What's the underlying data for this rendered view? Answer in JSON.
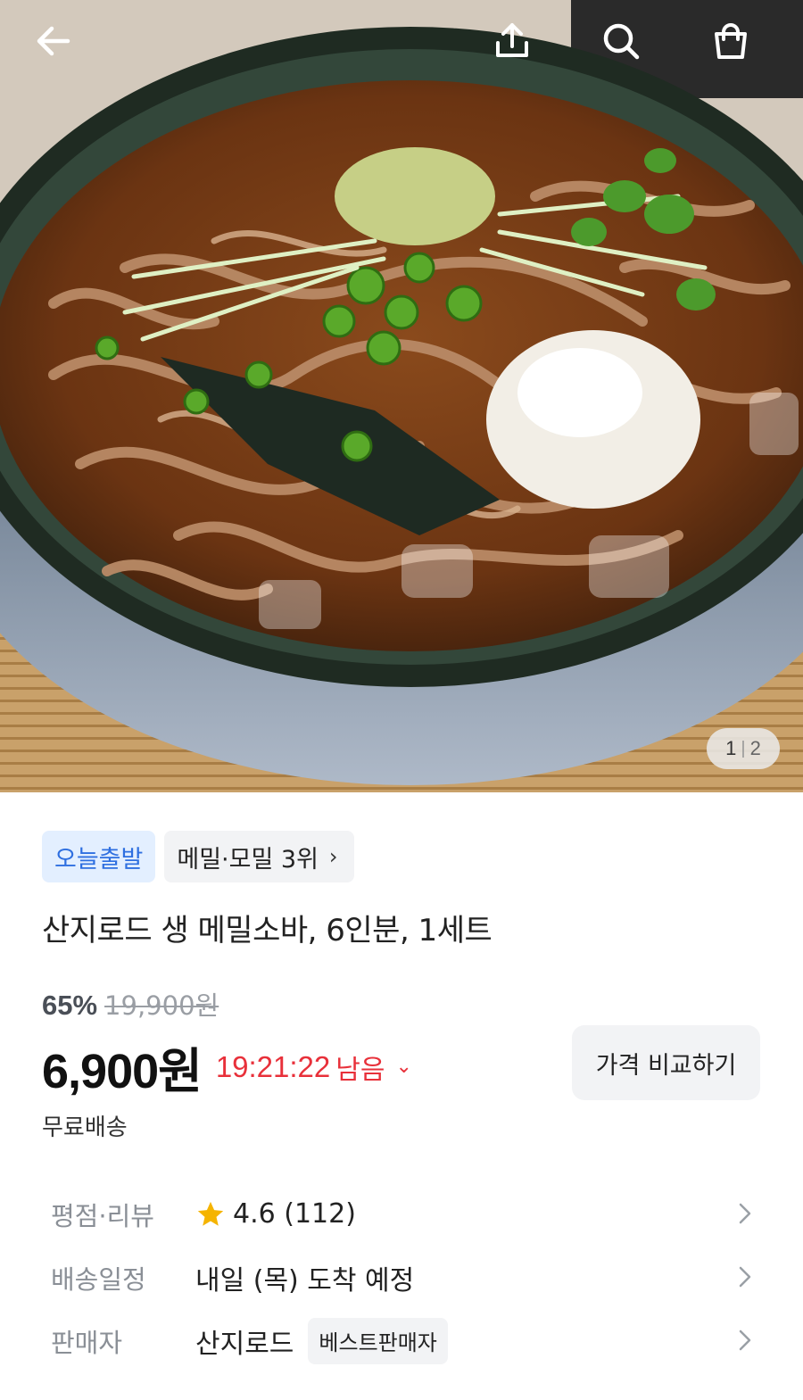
{
  "topbar": {
    "icons": [
      "back-arrow-icon",
      "share-icon",
      "search-icon",
      "shopping-bag-icon"
    ]
  },
  "gallery": {
    "current": "1",
    "total": "2",
    "separator": "|"
  },
  "badges": {
    "today": "오늘출발",
    "rank": "메밀·모밀 3위",
    "rank_chevron": "›"
  },
  "product": {
    "title": "산지로드 생 메밀소바, 6인분, 1세트"
  },
  "pricing": {
    "discount": "65%",
    "original_price": "19,900원",
    "price": "6,900원",
    "timer": "19:21:22",
    "timer_suffix": "남음",
    "timer_chevron": "⌄",
    "compare_label": "가격 비교하기",
    "shipping": "무료배송"
  },
  "details": {
    "rating_label": "평점·리뷰",
    "rating_value": "4.6 (112)",
    "delivery_label": "배송일정",
    "delivery_value": "내일 (목) 도착 예정",
    "seller_label": "판매자",
    "seller_value": "산지로드",
    "seller_badge": "베스트판매자"
  },
  "colors": {
    "accent_red": "#e8303a",
    "badge_blue_text": "#2e6fe0",
    "badge_blue_bg": "#e3efff",
    "star": "#f5b400"
  }
}
